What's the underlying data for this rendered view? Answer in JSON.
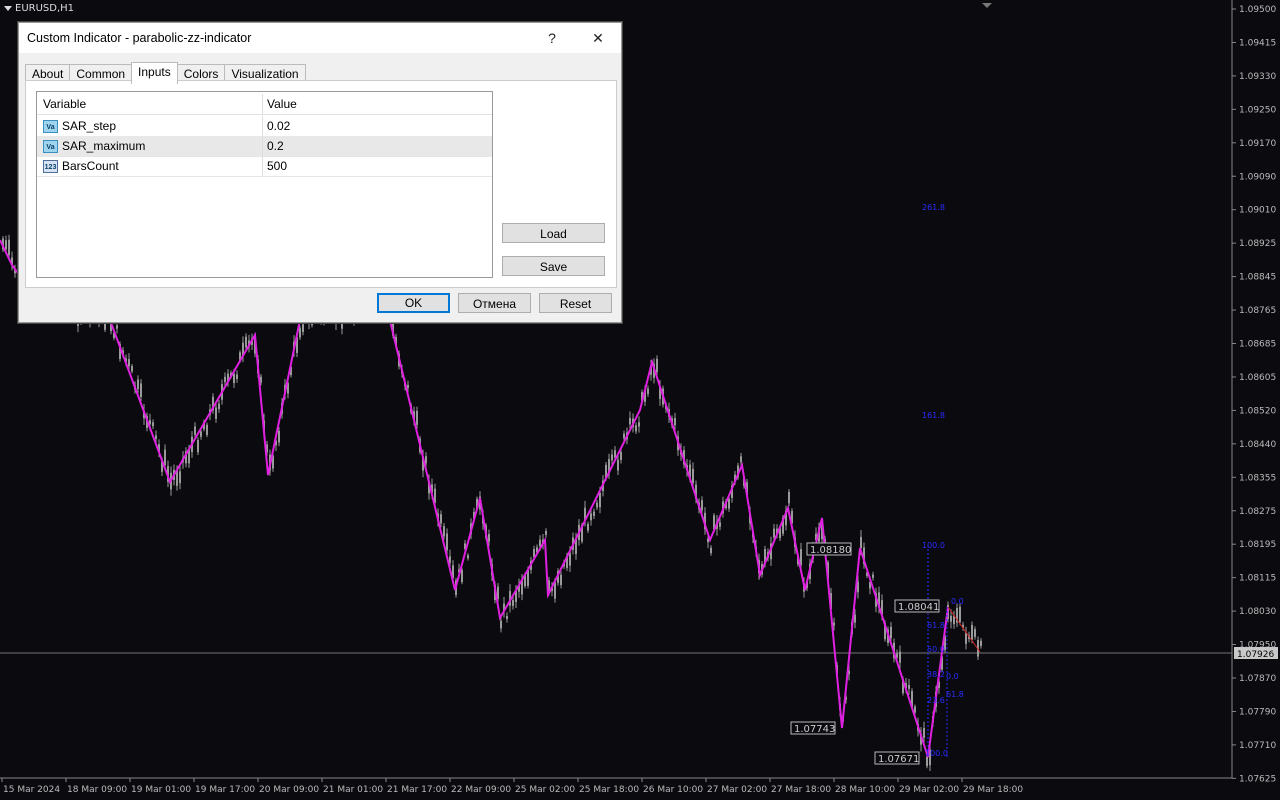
{
  "chart": {
    "symbol": "EURUSD,H1",
    "price_levels": [
      "1.09500",
      "1.09415",
      "1.09330",
      "1.09250",
      "1.09170",
      "1.09090",
      "1.09010",
      "1.08925",
      "1.08845",
      "1.08765",
      "1.08685",
      "1.08605",
      "1.08520",
      "1.08440",
      "1.08355",
      "1.08275",
      "1.08195",
      "1.08115",
      "1.08030",
      "1.07950",
      "1.07870",
      "1.07790",
      "1.07710",
      "1.07625"
    ],
    "current_price": "1.07926",
    "time_labels": [
      "15 Mar 2024",
      "18 Mar 09:00",
      "19 Mar 01:00",
      "19 Mar 17:00",
      "20 Mar 09:00",
      "21 Mar 01:00",
      "21 Mar 17:00",
      "22 Mar 09:00",
      "25 Mar 02:00",
      "25 Mar 18:00",
      "26 Mar 10:00",
      "27 Mar 02:00",
      "27 Mar 18:00",
      "28 Mar 10:00",
      "29 Mar 02:00",
      "29 Mar 18:00"
    ],
    "price_tags": [
      "1.08180",
      "1.08041",
      "1.07743",
      "1.07671"
    ],
    "fib_labels": [
      "261.8",
      "161.8",
      "100.0",
      "0.0",
      "61.8",
      "50.0",
      "38.2",
      "23.6",
      "0.0",
      "61.8",
      "100.0"
    ],
    "colors": {
      "zigzag": "#e020e0",
      "fib": "#2b2bff",
      "candle": "#9a9a9a",
      "background": "#0a0a0f"
    }
  },
  "dialog": {
    "title": "Custom Indicator - parabolic-zz-indicator",
    "help_icon": "?",
    "close_icon": "✕",
    "tabs": [
      "About",
      "Common",
      "Inputs",
      "Colors",
      "Visualization"
    ],
    "active_tab": "Inputs",
    "grid": {
      "headers": {
        "variable": "Variable",
        "value": "Value"
      },
      "rows": [
        {
          "icon": "double-icon",
          "icon_text": "Va",
          "name": "SAR_step",
          "value": "0.02"
        },
        {
          "icon": "double-icon",
          "icon_text": "Va",
          "name": "SAR_maximum",
          "value": "0.2"
        },
        {
          "icon": "integer-icon",
          "icon_text": "123",
          "name": "BarsCount",
          "value": "500"
        }
      ]
    },
    "buttons": {
      "load": "Load",
      "save": "Save",
      "ok": "OK",
      "cancel": "Отмена",
      "reset": "Reset"
    }
  }
}
